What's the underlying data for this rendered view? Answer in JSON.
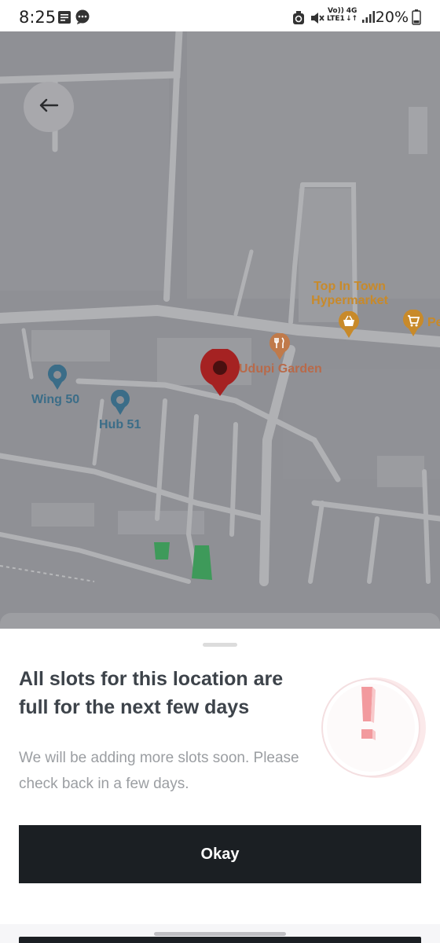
{
  "status_bar": {
    "time": "8:25",
    "network_top": "Vo))",
    "network_bottom": "LTE1",
    "network_gen": "4G",
    "battery": "20%",
    "icons": [
      "notes-icon",
      "message-icon",
      "recycle-icon",
      "mute-icon",
      "signal-icon",
      "battery-icon"
    ]
  },
  "map": {
    "labels": {
      "hypermarket": "Top In Town\nHypermarket",
      "restaurant": "Udupi Garden",
      "wing": "Wing 50",
      "hub": "Hub 51",
      "edge": "Pe"
    },
    "colors": {
      "background": "#8f9095",
      "road": "#b0b1b4",
      "pin": "#a52222",
      "poi_orange": "#c88a2a",
      "poi_blue": "#3b6d88",
      "park": "#3e9a5a"
    }
  },
  "sheet": {
    "title": "All slots for this location are full for the next few days",
    "subtitle": "We will be adding more slots soon. Please check back in a few days.",
    "button_label": "Okay",
    "accent": "#1b1f23"
  }
}
